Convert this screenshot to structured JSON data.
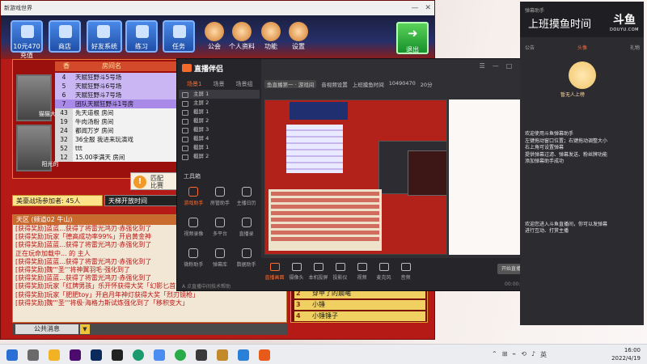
{
  "game": {
    "title": "新游戏世界",
    "nav": [
      {
        "label": "10元470\n充值",
        "icon": "coin-icon"
      },
      {
        "label": "商店",
        "icon": "shop-icon"
      },
      {
        "label": "好友系统",
        "icon": "friends-icon"
      },
      {
        "label": "练习",
        "icon": "practice-icon"
      },
      {
        "label": "任务",
        "icon": "task-icon"
      }
    ],
    "nav_extra": [
      {
        "label": "公会",
        "icon": "guild-icon"
      },
      {
        "label": "个人资料",
        "icon": "profile-icon"
      },
      {
        "label": "功能",
        "icon": "feature-icon"
      },
      {
        "label": "设置",
        "icon": "settings-icon"
      }
    ],
    "exit_label": "退出",
    "room_header": {
      "col1": "香",
      "col2": "房间名"
    },
    "avatar_cards": [
      "猫猫大师",
      "阳光的"
    ],
    "rooms": [
      {
        "num": "4",
        "name": "天赋狂野斗5号场",
        "style": "hl"
      },
      {
        "num": "5",
        "name": "天赋狂野斗6号场",
        "style": "hl"
      },
      {
        "num": "6",
        "name": "天赋狂野斗7号场",
        "style": "hl"
      },
      {
        "num": "7",
        "name": "团队天赋狂野斗1号房",
        "style": "sel"
      },
      {
        "num": "43",
        "name": "先天道根  房间",
        "style": ""
      },
      {
        "num": "19",
        "name": "牛肉汤粉  房间",
        "style": ""
      },
      {
        "num": "24",
        "name": "都闻万岁  房间",
        "style": ""
      },
      {
        "num": "32",
        "name": "36全服  我进来玩演戏",
        "style": ""
      },
      {
        "num": "52",
        "name": "ttt",
        "style": ""
      },
      {
        "num": "12",
        "name": "15.00李满天  房间",
        "style": ""
      }
    ],
    "arena": "美豪战场参加者: 45人",
    "ladder": "天梯开放时间",
    "popup_lines": [
      "匹配",
      "比赛"
    ],
    "chat_tab": "天区 (频道02  牛山)",
    "chat_lines": [
      "[获得奖励]蓝蓝...获得了将雷光鸿刃·赤强化到了",
      "[获得奖励]玩家「德高成功率99%」开启黄金神",
      "[获得奖励]蓝蓝...获得了将雷光鸿刃·赤强化到了",
      "正在玩命加载中...         的 主人",
      "[获得奖励]蓝蓝...获得了将雷光鸿刃·赤强化到了",
      "[获得奖励]魏'''圣'''将神翼羽毛·强化到了",
      "[获得奖励]蓝蓝...获得了将雷光鸿刃·赤强化到了",
      "[获得奖励]玩家「红牌男孩」乐开怀获得大奖「幻影匕首」",
      "[获得奖励]玩家「肥肥toy」开启月年神灯获得大奖「烈刃镜枪」",
      "[获得奖励]魏'''圣'''将极·海格力斯试炼强化到了「移积变大」"
    ],
    "chat_channel": "公共消息",
    "team": [
      {
        "num": "2",
        "name": "穿甲了的晨曦"
      },
      {
        "num": "3",
        "name": "小锤"
      },
      {
        "num": "4",
        "name": "小锤锤子"
      }
    ]
  },
  "dialog": {
    "app_name": "直播伴侣",
    "tabs": [
      "场景1",
      "场景",
      "场景组"
    ],
    "scenes": [
      "主屏 1",
      "主屏 2",
      "截屏 1",
      "截屏 2",
      "截屏 3",
      "截屏 4",
      "截屏 1",
      "截屏 2"
    ],
    "tools_title": "工具箱",
    "tools": [
      "游戏助手",
      "房管助手",
      "主播日历",
      "视频录像",
      "多平台",
      "直播录",
      "微粉助手",
      "弹幕库",
      "数据助手"
    ],
    "footer_note": "A 点直播中间技术帮助",
    "topline": [
      "鱼直播第一 · 游戏间",
      "音视频设置",
      "上班摸鱼时间",
      "10490470",
      "20分"
    ],
    "toolbar": [
      "直播画面",
      "摄像头",
      "本机投屏",
      "投影仪",
      "视频",
      "麦克风",
      "音频"
    ],
    "start_label": "开始直播",
    "stat": "00:00:00"
  },
  "assistant": {
    "lines": [
      "欢迎使用斗鱼弹幕助手",
      "左键拖动窗口位置；右键拖动调整大小",
      "右上角可设置弹幕",
      "提供弹幕过滤、弹幕发送、粉丝牌功能",
      "添加弹幕助手成功",
      "",
      "",
      "",
      "",
      "",
      "",
      "",
      "",
      "",
      "欢迎您进入斗鱼直播间，你可以发弹幕",
      "进行互动、打赏主播"
    ]
  },
  "douyu": {
    "sub": "弹幕助手",
    "title": "上班摸鱼时间",
    "logo": "斗鱼",
    "logo_sub": "DOUYU.COM",
    "tabs": [
      "公告",
      "头像",
      "礼物"
    ],
    "mascot_caption": "暂无人上榜",
    "messages": [
      "欢迎使用斗鱼弹幕助手",
      "左键拖动窗口位置；右键拖动调整大小",
      "右上角可设置弹幕",
      "提供弹幕过滤、弹幕发送、粉丝牌功能",
      "添加弹幕助手成功",
      "",
      "",
      "",
      "",
      "",
      "",
      "",
      "",
      "欢迎您进入斗鱼直播间，你可以发弹幕",
      "进行互动、打赏主播"
    ]
  },
  "taskbar": {
    "time": "16:00",
    "date": "2022/4/19",
    "tray_icons": [
      "⌃",
      "⊞",
      "⌁",
      "⟲",
      "♪",
      "英"
    ]
  }
}
